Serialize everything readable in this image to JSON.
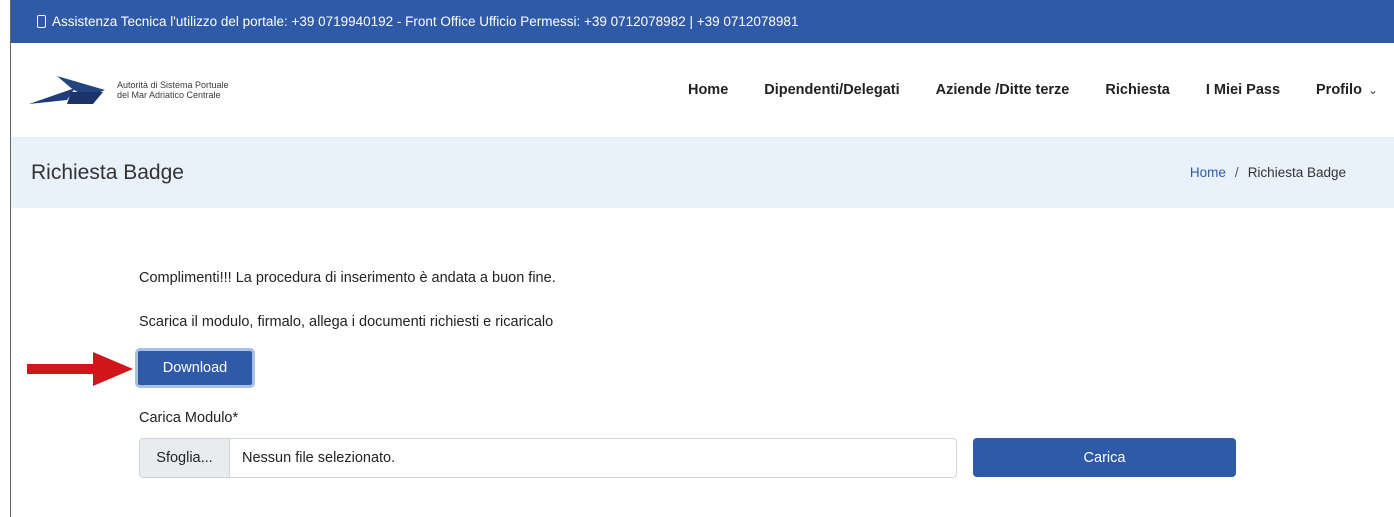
{
  "topbar": {
    "icon": "phone-icon",
    "text": "Assistenza Tecnica l'utilizzo del portale: +39 0719940192 - Front Office Ufficio Permessi: +39 0712078982 | +39 0712078981"
  },
  "logo": {
    "line1": "Autorità di Sistema Portuale",
    "line2": "del Mar Adriatico Centrale"
  },
  "nav": {
    "items": [
      {
        "label": "Home"
      },
      {
        "label": "Dipendenti/Delegati"
      },
      {
        "label": "Aziende /Ditte terze"
      },
      {
        "label": "Richiesta"
      },
      {
        "label": "I Miei Pass"
      },
      {
        "label": "Profilo"
      }
    ]
  },
  "page": {
    "title": "Richiesta Badge",
    "breadcrumb": {
      "home": "Home",
      "separator": "/",
      "current": "Richiesta Badge"
    }
  },
  "content": {
    "success_message": "Complimenti!!! La procedura di inserimento è andata a buon fine.",
    "instruction": "Scarica il modulo, firmalo, allega i documenti richiesti e ricaricalo",
    "download_label": "Download",
    "upload_label": "Carica Modulo*",
    "browse_label": "Sfoglia...",
    "file_value": "Nessun file selezionato.",
    "upload_button": "Carica"
  },
  "colors": {
    "primary": "#2e5aa8",
    "title_band": "#e9f1fb",
    "arrow": "#d0161b"
  }
}
